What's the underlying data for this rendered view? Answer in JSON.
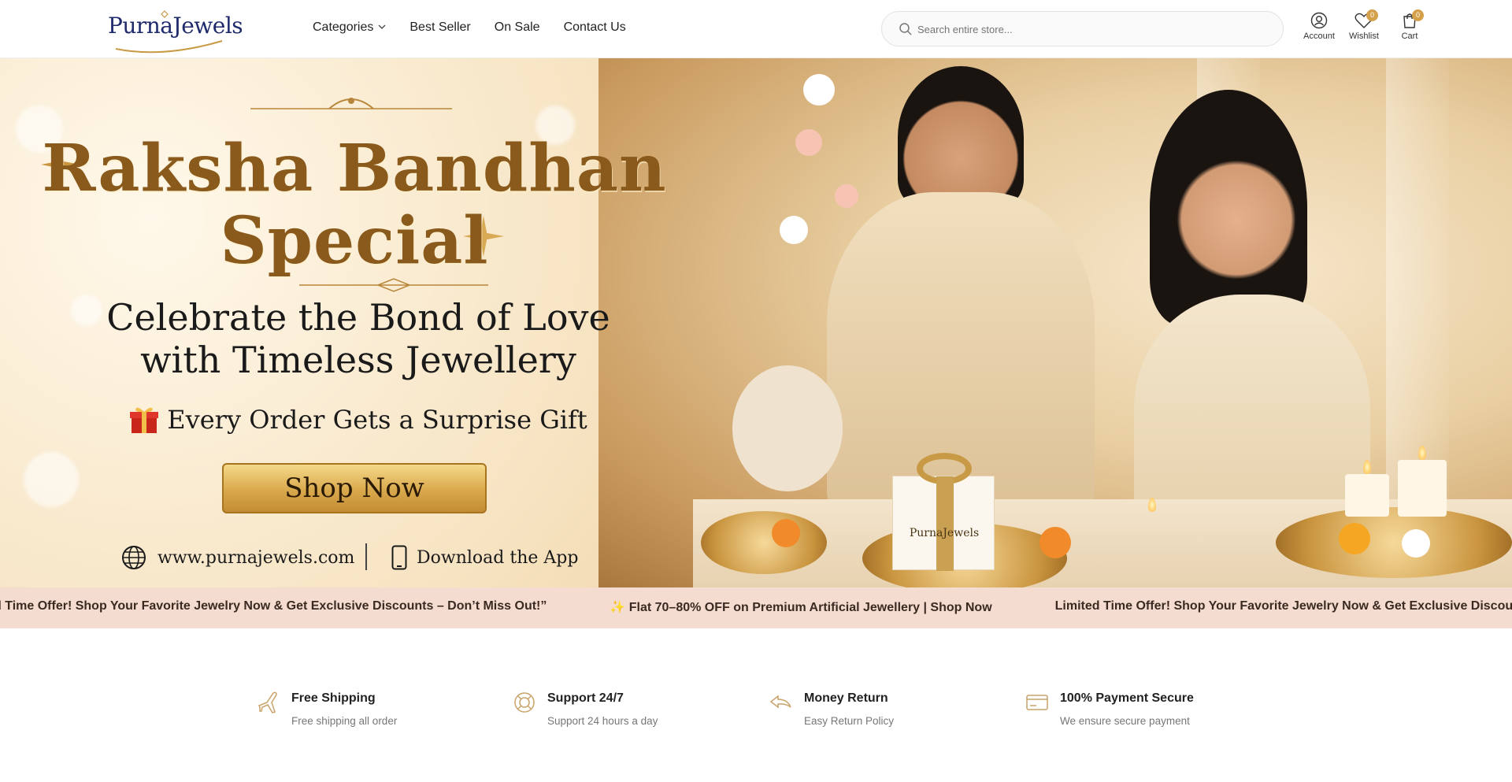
{
  "header": {
    "logo_text": "PurnaJewels",
    "nav": [
      {
        "label": "Categories",
        "has_dropdown": true
      },
      {
        "label": "Best Seller"
      },
      {
        "label": "On Sale"
      },
      {
        "label": "Contact Us"
      }
    ],
    "search": {
      "placeholder": "Search entire store...",
      "icon": "search-icon"
    },
    "account": {
      "label": "Account",
      "icon": "user-icon"
    },
    "wishlist": {
      "label": "Wishlist",
      "icon": "heart-icon",
      "count": "0"
    },
    "cart": {
      "label": "Cart",
      "icon": "bag-icon",
      "count": "0"
    }
  },
  "hero": {
    "title_line1": "Raksha Bandhan",
    "title_line2": "Special",
    "subtitle_line1": "Celebrate the Bond of Love",
    "subtitle_line2": "with Timeless Jewellery",
    "gift_line": "Every Order Gets a Surprise Gift",
    "cta": "Shop Now",
    "website": "www.purnajewels.com",
    "app_text": "Download the App",
    "gift_box_brand": "PurnaJewels",
    "colors": {
      "title_gold": "#8a5a1c",
      "button_gold": "#d9a84c"
    }
  },
  "marquee": {
    "items": [
      "d Time Offer! Shop Your Favorite Jewelry Now & Get Exclusive Discounts – Don’t Miss Out!”",
      "✨ Flat 70–80% OFF on Premium Artificial Jewellery | Shop Now",
      "Limited Time Offer! Shop Your Favorite Jewelry Now & Get Exclusive Discounts – Don’t Miss Ou"
    ],
    "background": "#f4ddd0"
  },
  "features": [
    {
      "title": "Free Shipping",
      "desc": "Free shipping all order",
      "icon": "plane-icon"
    },
    {
      "title": "Support 24/7",
      "desc": "Support 24 hours a day",
      "icon": "lifebuoy-icon"
    },
    {
      "title": "Money Return",
      "desc": "Easy Return Policy",
      "icon": "return-arrow-icon"
    },
    {
      "title": "100% Payment Secure",
      "desc": "We ensure secure payment",
      "icon": "credit-card-icon"
    }
  ]
}
